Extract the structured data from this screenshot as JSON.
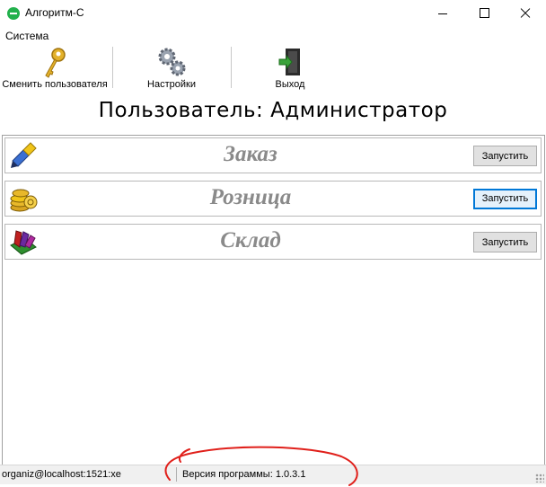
{
  "window": {
    "title": "Алгоритм-С"
  },
  "menu": {
    "items": [
      "Система"
    ]
  },
  "toolbar": {
    "switch_user_label": "Сменить пользователя",
    "settings_label": "Настройки",
    "exit_label": "Выход"
  },
  "user_caption": "Пользователь: Администратор",
  "modules": [
    {
      "name": "Заказ",
      "button": "Запустить",
      "icon": "brush-icon",
      "focused": false
    },
    {
      "name": "Розница",
      "button": "Запустить",
      "icon": "coins-icon",
      "focused": true
    },
    {
      "name": "Склад",
      "button": "Запустить",
      "icon": "books-icon",
      "focused": false
    }
  ],
  "status": {
    "connection": "organiz@localhost:1521:xe",
    "version": "Версия программы: 1.0.3.1"
  },
  "colors": {
    "accent": "#0078d7",
    "module_title": "#8a8a8a",
    "annotation": "#e0201b"
  }
}
